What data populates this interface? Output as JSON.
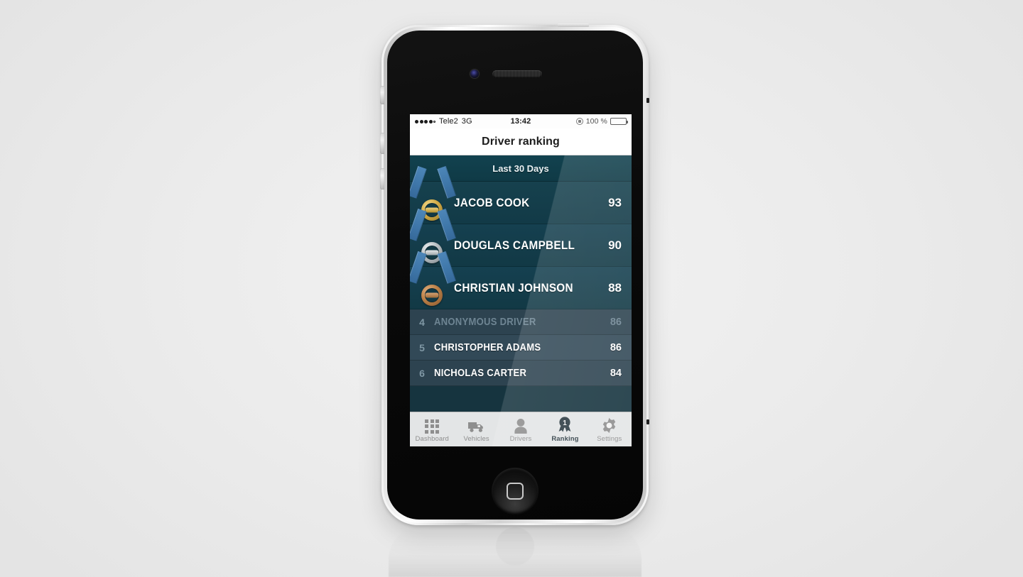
{
  "status_bar": {
    "carrier": "Tele2",
    "network": "3G",
    "time": "13:42",
    "battery_percent": "100 %",
    "signal_dots_filled": 4,
    "signal_dots_total": 5,
    "rotation_lock_icon": "rotation-lock-icon",
    "battery_icon": "battery-full-icon"
  },
  "nav": {
    "title": "Driver ranking"
  },
  "segment": {
    "label": "Last 30 Days"
  },
  "ranking": {
    "podium": [
      {
        "rank": "1",
        "name": "JACOB COOK",
        "score": "93",
        "medal": "gold",
        "medal_icon": "gold-steering-wheel-medal-icon"
      },
      {
        "rank": "2",
        "name": "DOUGLAS CAMPBELL",
        "score": "90",
        "medal": "silver",
        "medal_icon": "silver-steering-wheel-medal-icon"
      },
      {
        "rank": "3",
        "name": "CHRISTIAN JOHNSON",
        "score": "88",
        "medal": "bronze",
        "medal_icon": "bronze-steering-wheel-medal-icon"
      }
    ],
    "rest": [
      {
        "rank": "4",
        "name": "ANONYMOUS DRIVER",
        "score": "86",
        "dimmed": true
      },
      {
        "rank": "5",
        "name": "CHRISTOPHER ADAMS",
        "score": "86",
        "dimmed": false
      },
      {
        "rank": "6",
        "name": "NICHOLAS CARTER",
        "score": "84",
        "dimmed": false
      }
    ]
  },
  "tabbar": {
    "items": [
      {
        "label": "Dashboard",
        "icon": "grid-icon",
        "active": false
      },
      {
        "label": "Vehicles",
        "icon": "truck-icon",
        "active": false
      },
      {
        "label": "Drivers",
        "icon": "person-icon",
        "active": false
      },
      {
        "label": "Ranking",
        "icon": "medal-badge-icon",
        "active": true
      },
      {
        "label": "Settings",
        "icon": "gear-icon",
        "active": false
      }
    ]
  },
  "device": {
    "camera_icon": "front-camera-icon",
    "earpiece_icon": "earpiece-speaker-icon",
    "home_button_icon": "home-button-icon",
    "mute_switch_icon": "mute-switch-icon",
    "volume_up_icon": "volume-up-button-icon",
    "volume_down_icon": "volume-down-button-icon",
    "power_button_icon": "power-button-icon"
  },
  "colors": {
    "teal_dark": "#123945",
    "teal_header": "#0f3a46",
    "row_plain": "#2d4350",
    "row_plain_alt": "#324957",
    "gold": "#d4ad4a",
    "silver": "#b9c0c4",
    "bronze": "#bd8249",
    "ribbon_blue": "#3f77a9",
    "tab_active": "#2b3a42",
    "tab_inactive": "#8e8e8e",
    "page_bg": "#ececec"
  }
}
